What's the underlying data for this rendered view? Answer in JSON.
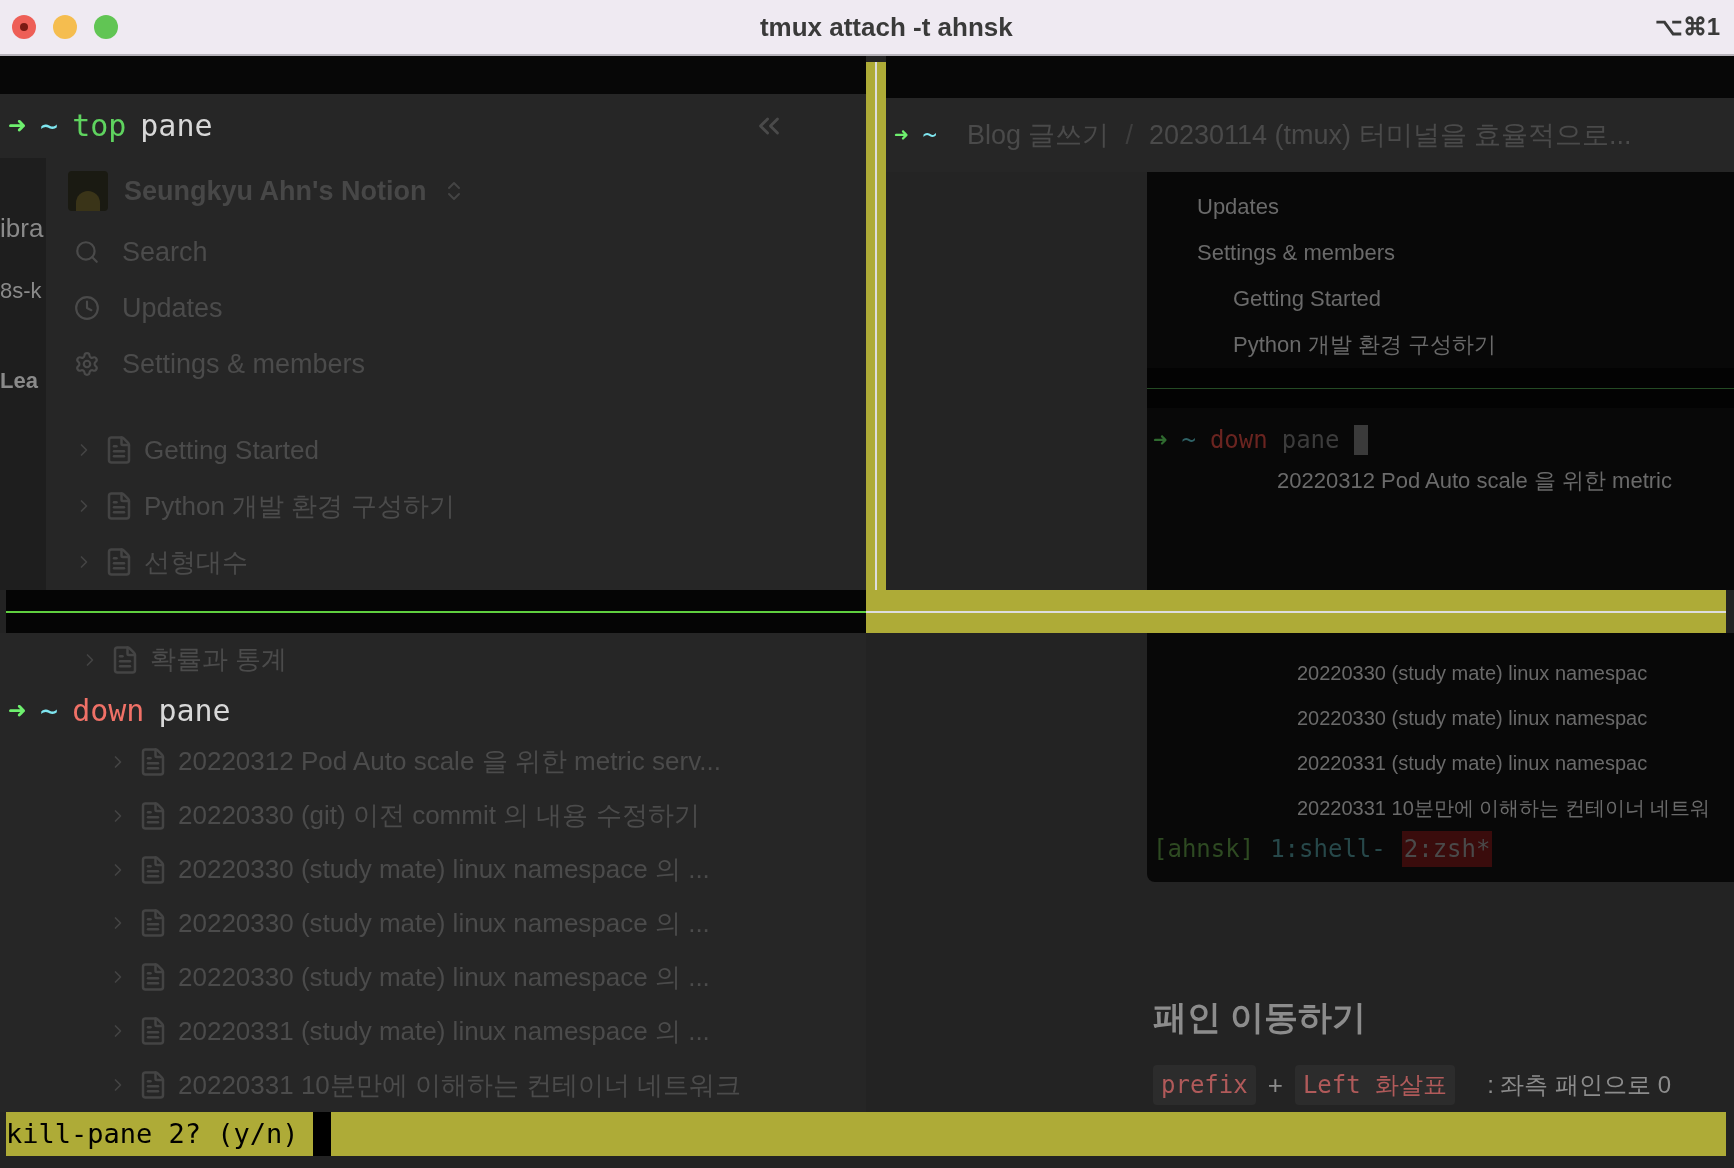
{
  "window": {
    "title": "tmux attach -t ahnsk",
    "shortcut": "⌥⌘1"
  },
  "top_pane": {
    "arrow": "➜",
    "dir": "~",
    "command": "top",
    "argument": "pane"
  },
  "background_fragments": [
    "ibra",
    "8s-k",
    "Lea"
  ],
  "notion_sidebar": {
    "workspace": "Seungkyu Ahn's Notion",
    "menu": [
      {
        "kind": "search",
        "label": "Search"
      },
      {
        "kind": "clock",
        "label": "Updates"
      },
      {
        "kind": "gear",
        "label": "Settings & members"
      }
    ],
    "pages": [
      "Getting Started",
      "Python 개발 환경 구성하기",
      "선형대수",
      "확률과 통계"
    ]
  },
  "right_pane": {
    "arrow": "➜",
    "dir": "~",
    "breadcrumb": [
      "Blog 글쓰기",
      "20230114 (tmux) 터미널을 효율적으로..."
    ],
    "separator": "/"
  },
  "embedded_screenshot": {
    "upper_lines": [
      "Updates",
      "Settings & members",
      "Getting Started",
      "Python 개발 환경 구성하기"
    ],
    "prompt": {
      "arrow": "➜",
      "dir": "~",
      "command": "down",
      "argument": "pane"
    },
    "after_prompt": "20220312 Pod Auto scale 을 위한 metric",
    "lower_lines": [
      "20220330 (study mate) linux namespac",
      "20220330 (study mate) linux namespac",
      "20220331 (study mate) linux namespac",
      "20220331 10분만에 이해하는 컨테이너 네트워"
    ],
    "status_bar": {
      "session": "[ahnsk]",
      "windows": [
        {
          "label": "1:shell-",
          "selected": false
        },
        {
          "label": "2:zsh*",
          "selected": true
        }
      ]
    }
  },
  "down_pane": {
    "arrow": "➜",
    "dir": "~",
    "command": "down",
    "argument": "pane",
    "pages": [
      "20220312 Pod Auto scale 을 위한 metric serv...",
      "20220330 (git) 이전 commit 의 내용 수정하기",
      "20220330 (study mate) linux namespace 의 ...",
      "20220330 (study mate) linux namespace 의 ...",
      "20220330 (study mate) linux namespace 의 ...",
      "20220331 (study mate) linux namespace 의 ...",
      "20220331 10분만에 이해하는 컨테이너 네트워크"
    ]
  },
  "article": {
    "heading": "패인 이동하기",
    "keys": [
      "prefix",
      "Left 화살표"
    ],
    "plus": "+",
    "description": ": 좌측 패인으로 0"
  },
  "message": {
    "text": "kill-pane 2? (y/n)"
  }
}
